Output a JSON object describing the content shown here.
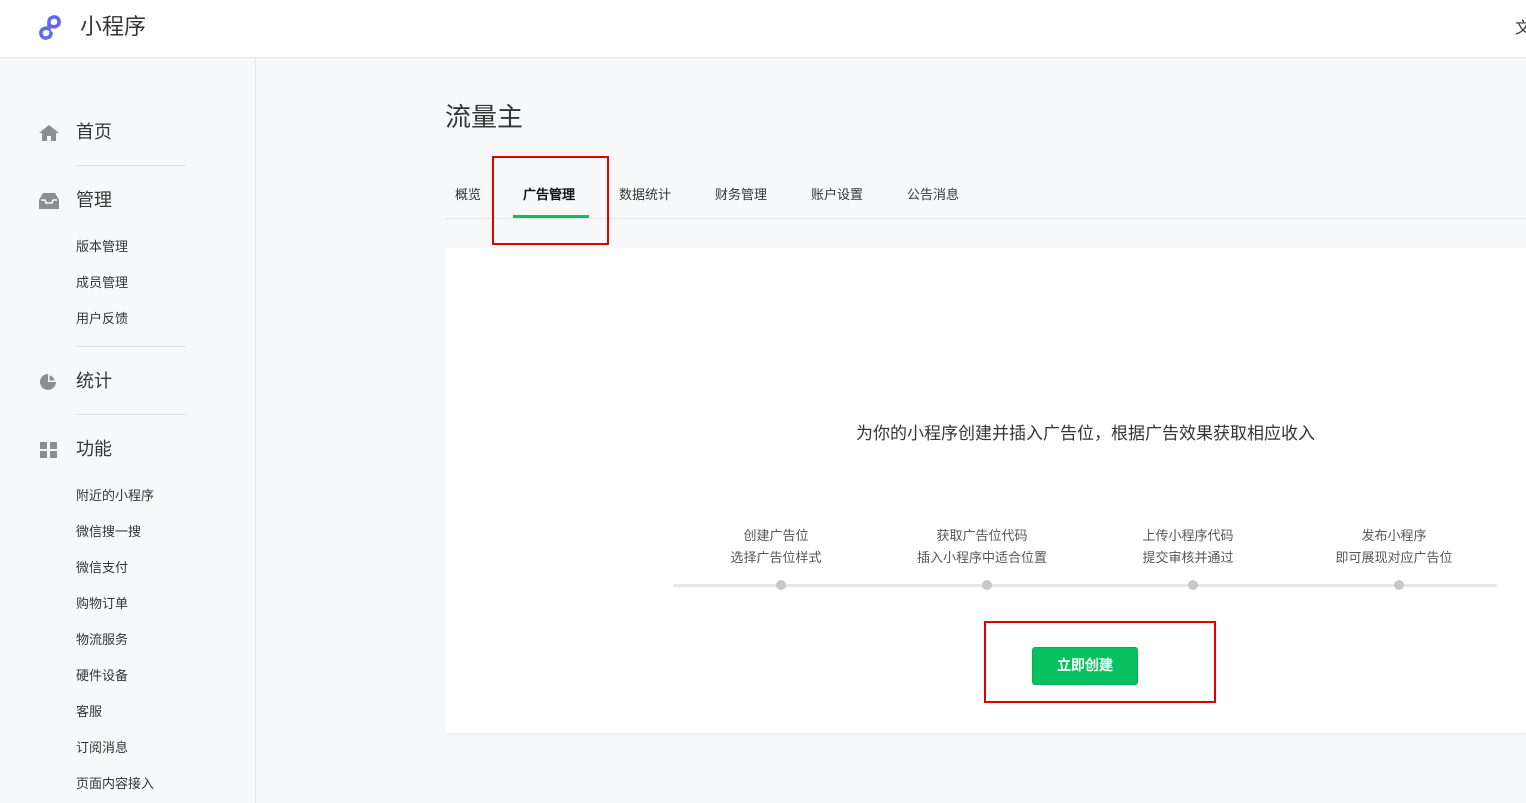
{
  "header": {
    "app_title": "小程序",
    "right_text": "文"
  },
  "sidebar": {
    "groups": [
      {
        "label": "首页",
        "icon": "home-icon"
      },
      {
        "label": "管理",
        "icon": "inbox-icon",
        "items": [
          "版本管理",
          "成员管理",
          "用户反馈"
        ]
      },
      {
        "label": "统计",
        "icon": "pie-chart-icon"
      },
      {
        "label": "功能",
        "icon": "grid-icon",
        "items": [
          "附近的小程序",
          "微信搜一搜",
          "微信支付",
          "购物订单",
          "物流服务",
          "硬件设备",
          "客服",
          "订阅消息",
          "页面内容接入"
        ]
      }
    ]
  },
  "main": {
    "title": "流量主",
    "tabs": [
      {
        "label": "概览",
        "active": false
      },
      {
        "label": "广告管理",
        "active": true
      },
      {
        "label": "数据统计",
        "active": false
      },
      {
        "label": "财务管理",
        "active": false
      },
      {
        "label": "账户设置",
        "active": false
      },
      {
        "label": "公告消息",
        "active": false
      }
    ],
    "card": {
      "headline": "为你的小程序创建并插入广告位，根据广告效果获取相应收入",
      "steps": [
        {
          "line1": "创建广告位",
          "line2": "选择广告位样式"
        },
        {
          "line1": "获取广告位代码",
          "line2": "插入小程序中适合位置"
        },
        {
          "line1": "上传小程序代码",
          "line2": "提交审核并通过"
        },
        {
          "line1": "发布小程序",
          "line2": "即可展现对应广告位"
        }
      ],
      "button_label": "立即创建"
    }
  },
  "colors": {
    "accent": "#07c160",
    "annotation": "#e00000"
  }
}
